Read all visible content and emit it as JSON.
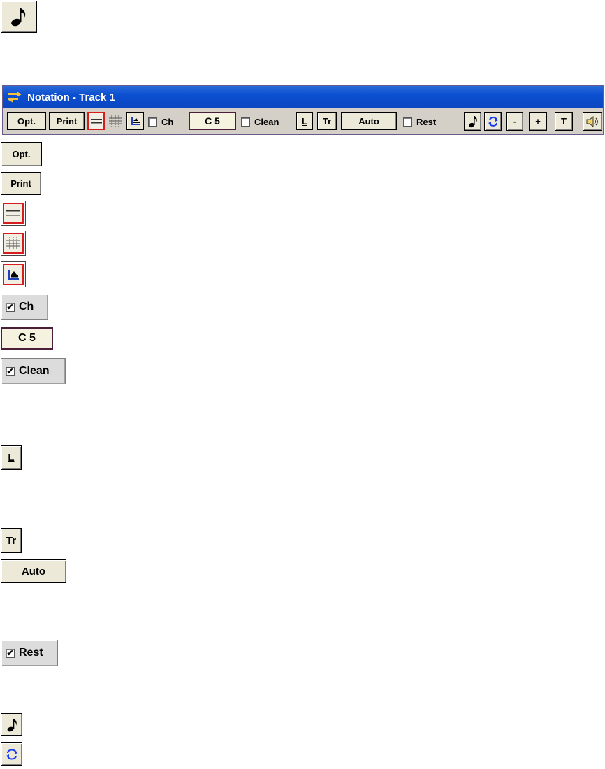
{
  "window": {
    "title": "Notation - Track 1",
    "title_icon": "notation-window-icon"
  },
  "toolbar": {
    "opt_label": "Opt.",
    "print_label": "Print",
    "staff_icon": "staff-lines-icon",
    "grid_icon": "grid-icon",
    "editor_icon": "notation-editor-icon",
    "ch_label": "Ch",
    "ch_checked": false,
    "key_value": "C 5",
    "clean_label": "Clean",
    "clean_checked": false,
    "lyrics_label": "L",
    "tr_label": "Tr",
    "auto_label": "Auto",
    "rest_label": "Rest",
    "rest_checked": false,
    "note_icon": "eighth-note-icon",
    "loop_icon": "loop-icon",
    "minus_label": "-",
    "plus_label": "+",
    "t_label": "T",
    "speaker_icon": "speaker-icon"
  },
  "legend": {
    "opt_label": "Opt.",
    "print_label": "Print",
    "ch_label": "Ch",
    "ch_checked": true,
    "key_value": "C 5",
    "clean_label": "Clean",
    "clean_checked": true,
    "lyrics_label": "L",
    "tr_label": "Tr",
    "auto_label": "Auto",
    "rest_label": "Rest",
    "rest_checked": true,
    "check_mark": "✔"
  }
}
